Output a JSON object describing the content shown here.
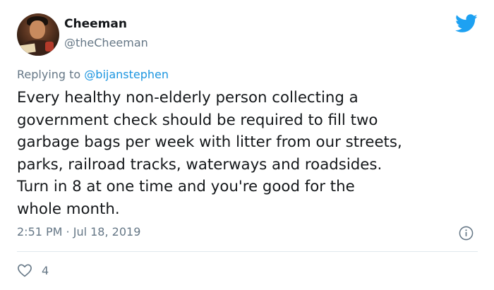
{
  "author": {
    "name": "Cheeman",
    "handle": "@theCheeman"
  },
  "reply": {
    "prefix": "Replying to ",
    "mention": "@bijanstephen"
  },
  "tweet": {
    "text": "Every healthy non-elderly person collecting a\ngovernment check should be required to fill two\ngarbage bags per week with litter from our streets,\nparks, railroad tracks, waterways and roadsides.\nTurn in 8 at one time and you're good for the\nwhole month.",
    "timestamp": "2:51 PM · Jul 18, 2019"
  },
  "engagement": {
    "likes": "4"
  },
  "icons": {
    "brand": "twitter-bird-icon",
    "info": "info-icon",
    "like": "heart-icon"
  },
  "colors": {
    "brand": "#1da1f2",
    "text": "#14171a",
    "secondary": "#657786",
    "link": "#1b95e0",
    "divider": "#e1e8ed"
  }
}
